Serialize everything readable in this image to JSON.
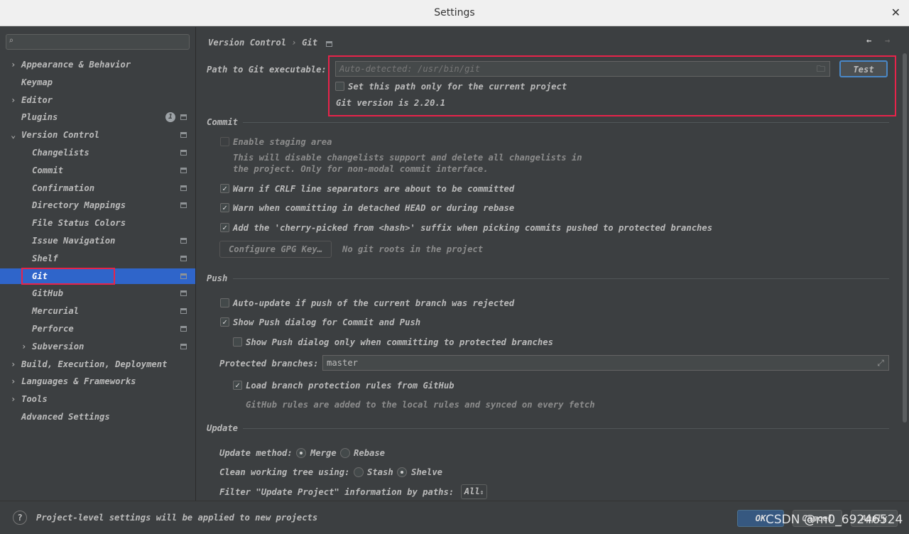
{
  "window": {
    "title": "Settings",
    "close": "✕"
  },
  "sidebar": {
    "items": [
      {
        "label": "Appearance & Behavior",
        "arrow": "›"
      },
      {
        "label": "Keymap"
      },
      {
        "label": "Editor",
        "arrow": "›"
      },
      {
        "label": "Plugins",
        "badge": "1"
      },
      {
        "label": "Version Control",
        "arrow": "⌄"
      },
      {
        "label": "Changelists"
      },
      {
        "label": "Commit"
      },
      {
        "label": "Confirmation"
      },
      {
        "label": "Directory Mappings"
      },
      {
        "label": "File Status Colors"
      },
      {
        "label": "Issue Navigation"
      },
      {
        "label": "Shelf"
      },
      {
        "label": "Git"
      },
      {
        "label": "GitHub"
      },
      {
        "label": "Mercurial"
      },
      {
        "label": "Perforce"
      },
      {
        "label": "Subversion",
        "arrow": "›"
      },
      {
        "label": "Build, Execution, Deployment",
        "arrow": "›"
      },
      {
        "label": "Languages & Frameworks",
        "arrow": "›"
      },
      {
        "label": "Tools",
        "arrow": "›"
      },
      {
        "label": "Advanced Settings"
      }
    ]
  },
  "breadcrumb": {
    "parent": "Version Control",
    "sep": "›",
    "current": "Git"
  },
  "git": {
    "path_label": "Path to Git executable:",
    "path_placeholder": "Auto-detected: /usr/bin/git",
    "test": "Test",
    "project_only": "Set this path only for the current project",
    "version": "Git version is 2.20.1"
  },
  "commit": {
    "header": "Commit",
    "staging": "Enable staging area",
    "staging_note1": "This will disable changelists support and delete all changelists in",
    "staging_note2": "the project. Only for non-modal commit interface.",
    "crlf": "Warn if CRLF line separators are about to be committed",
    "detached": "Warn when committing in detached HEAD or during rebase",
    "cherry": "Add the 'cherry-picked from <hash>' suffix when picking commits pushed to protected branches",
    "gpg": "Configure GPG Key…",
    "no_roots": "No git roots in the project"
  },
  "push": {
    "header": "Push",
    "auto_update": "Auto-update if push of the current branch was rejected",
    "show_dialog": "Show Push dialog for Commit and Push",
    "only_protected": "Show Push dialog only when committing to protected branches",
    "protected_label": "Protected branches:",
    "protected_value": "master",
    "load_rules": "Load branch protection rules from GitHub",
    "rules_note": "GitHub rules are added to the local rules and synced on every fetch"
  },
  "update": {
    "header": "Update",
    "method_label": "Update method:",
    "merge": "Merge",
    "rebase": "Rebase",
    "clean_label": "Clean working tree using:",
    "stash": "Stash",
    "shelve": "Shelve",
    "filter_label": "Filter \"Update Project\" information by paths:",
    "filter_value": "All"
  },
  "footer": {
    "help": "?",
    "note": "Project-level settings will be applied to new projects",
    "ok": "OK",
    "cancel": "Cancel",
    "apply": "Apply"
  },
  "watermark": "CSDN @m0_69246524"
}
